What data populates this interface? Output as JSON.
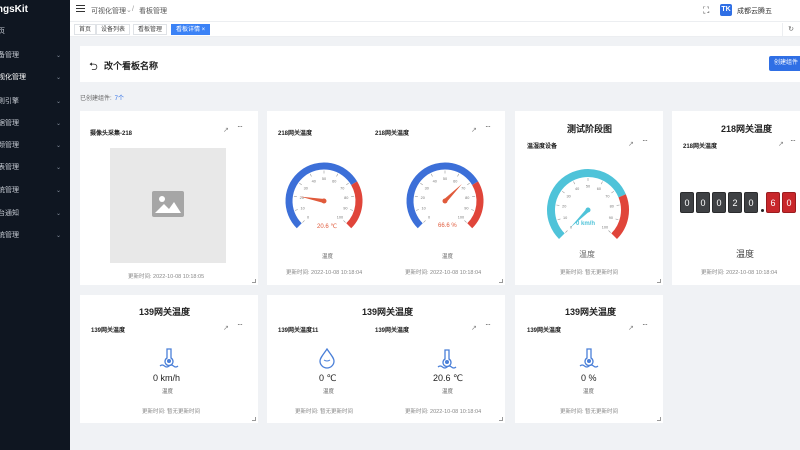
{
  "app": {
    "brand": "hingsKit"
  },
  "sidebar": {
    "items": [
      {
        "label": "页",
        "active": false,
        "chevron": false
      },
      {
        "label": "备管理",
        "active": false,
        "chevron": true
      },
      {
        "label": "视化管理",
        "active": true,
        "chevron": true
      },
      {
        "label": "则引擎",
        "active": false,
        "chevron": true
      },
      {
        "label": "据管理",
        "active": false,
        "chevron": true
      },
      {
        "label": "频管理",
        "active": false,
        "chevron": true
      },
      {
        "label": "表管理",
        "active": false,
        "chevron": true
      },
      {
        "label": "统管理",
        "active": false,
        "chevron": true
      },
      {
        "label": "台通知",
        "active": false,
        "chevron": true
      },
      {
        "label": "统管理",
        "active": false,
        "chevron": true
      }
    ]
  },
  "header": {
    "breadcrumb_1": "可视化管理",
    "breadcrumb_sep": "/",
    "breadcrumb_2": "看板管理",
    "user": "成都云腾五"
  },
  "tabs": [
    {
      "label": "首页",
      "active": false
    },
    {
      "label": "设备列表",
      "active": false
    },
    {
      "label": "看板管理",
      "active": false
    },
    {
      "label": "看板详情 ×",
      "active": true
    }
  ],
  "board": {
    "title": "改个看板名称",
    "create_label": "创建组件",
    "count_label": "已创建组件:",
    "count_value": "7个"
  },
  "cards": {
    "camera": {
      "subtitle": "摄像头采集-218",
      "updated": "更新时间: 2022-10-08 10:18:05"
    },
    "gauge_pair": {
      "left_sub": "218网关温度",
      "right_sub": "218网关温度",
      "left_value": "20.6 ℃",
      "right_value": "66.6 %",
      "left_label": "温度",
      "right_label": "温度",
      "left_updated": "更新时间: 2022-10-08 10:18:04",
      "right_updated": "更新时间: 2022-10-08 10:18:04",
      "left_reading": 20.6,
      "right_reading": 66.6
    },
    "test_gauge": {
      "title": "测试阶段图",
      "subtitle": "温湿度设备",
      "value": "0 km/h",
      "label": "温度",
      "updated": "更新时间: 暂无更新时间",
      "reading": 0
    },
    "odometer": {
      "title": "218网关温度",
      "subtitle": "218网关温度",
      "digits": [
        "0",
        "0",
        "0",
        "2",
        "0"
      ],
      "decimals": [
        "6",
        "0"
      ],
      "label": "温度",
      "updated": "更新时间: 2022-10-08 10:18:04"
    },
    "row2_a": {
      "title": "139网关温度",
      "subtitle": "139网关温度",
      "value": "0 km/h",
      "label": "温度",
      "updated": "更新时间: 暂无更新时间"
    },
    "row2_b": {
      "title": "139网关温度",
      "left_sub": "139网关温度11",
      "right_sub": "139网关温度",
      "left_value": "0 ℃",
      "right_value": "20.6 ℃",
      "left_label": "温度",
      "right_label": "温度",
      "left_updated": "更新时间: 暂无更新时间",
      "right_updated": "更新时间: 2022-10-08 10:18:04"
    },
    "row2_c": {
      "title": "139网关温度",
      "subtitle": "139网关温度",
      "value": "0 %",
      "label": "温度",
      "updated": "更新时间: 暂无更新时间"
    }
  },
  "gauge_ticks": [
    "0",
    "10",
    "20",
    "30",
    "40",
    "50",
    "60",
    "70",
    "80",
    "90",
    "100"
  ],
  "colors": {
    "accent": "#2f6fe5",
    "gauge_blue": "#3c6fd8",
    "gauge_red": "#e0453a",
    "needle": "#e05a3b",
    "test_teal": "#4fc3d9",
    "test_red": "#e0453a"
  }
}
